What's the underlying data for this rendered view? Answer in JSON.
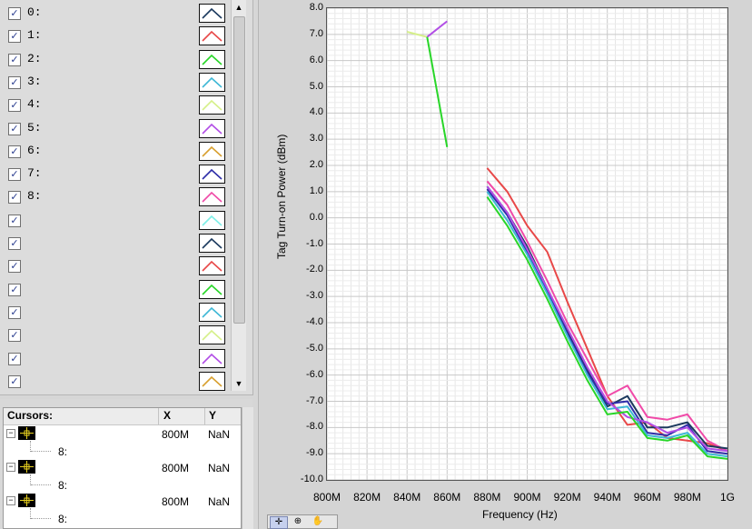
{
  "legend": {
    "plots": [
      {
        "label": "0:",
        "color": "#1c3a5e"
      },
      {
        "label": "1:",
        "color": "#e84848"
      },
      {
        "label": "2:",
        "color": "#28d628"
      },
      {
        "label": "3:",
        "color": "#3fb8d6"
      },
      {
        "label": "4:",
        "color": "#d6f08a"
      },
      {
        "label": "5:",
        "color": "#b24ee6"
      },
      {
        "label": "6:",
        "color": "#d8a030"
      },
      {
        "label": "7:",
        "color": "#2e2ea8"
      },
      {
        "label": "8:",
        "color": "#f04aa8"
      },
      {
        "label": "",
        "color": "#7ef0e8"
      },
      {
        "label": "",
        "color": "#1c3a5e"
      },
      {
        "label": "",
        "color": "#e84848"
      },
      {
        "label": "",
        "color": "#28d628"
      },
      {
        "label": "",
        "color": "#3fb8d6"
      },
      {
        "label": "",
        "color": "#d6f08a"
      },
      {
        "label": "",
        "color": "#b24ee6"
      },
      {
        "label": "",
        "color": "#d8a030"
      }
    ],
    "check_glyph": "☑"
  },
  "cursors": {
    "headers": {
      "name": "Cursors:",
      "x": "X",
      "y": "Y"
    },
    "rows": [
      {
        "x": "800M",
        "y": "NaN",
        "sub": "8:"
      },
      {
        "x": "800M",
        "y": "NaN",
        "sub": "8:"
      },
      {
        "x": "800M",
        "y": "NaN",
        "sub": "8:"
      }
    ]
  },
  "chart_data": {
    "type": "line",
    "xlabel": "Frequency (Hz)",
    "ylabel": "Tag Turn-on Power (dBm)",
    "xlim": [
      800,
      1000
    ],
    "ylim": [
      -10,
      8
    ],
    "x_unit": "MHz",
    "xticks": [
      "800M",
      "820M",
      "840M",
      "860M",
      "880M",
      "900M",
      "920M",
      "940M",
      "960M",
      "980M",
      "1G"
    ],
    "yticks": [
      "8.0",
      "7.0",
      "6.0",
      "5.0",
      "4.0",
      "3.0",
      "2.0",
      "1.0",
      "0.0",
      "-1.0",
      "-2.0",
      "-3.0",
      "-4.0",
      "-5.0",
      "-6.0",
      "-7.0",
      "-8.0",
      "-9.0",
      "-10.0"
    ],
    "grid": true,
    "series": [
      {
        "color": "#d6f08a",
        "points": [
          [
            840,
            7.1
          ],
          [
            850,
            6.9
          ]
        ]
      },
      {
        "color": "#b24ee6",
        "points": [
          [
            850,
            6.9
          ],
          [
            860,
            7.5
          ]
        ]
      },
      {
        "color": "#28d628",
        "points": [
          [
            850,
            6.9
          ],
          [
            860,
            2.7
          ]
        ]
      },
      {
        "color": "#e84848",
        "points": [
          [
            880,
            1.9
          ],
          [
            890,
            1.0
          ],
          [
            900,
            -0.3
          ],
          [
            910,
            -1.3
          ],
          [
            920,
            -3.2
          ],
          [
            930,
            -5.0
          ],
          [
            940,
            -6.8
          ],
          [
            950,
            -7.9
          ],
          [
            960,
            -7.8
          ],
          [
            970,
            -8.4
          ],
          [
            980,
            -8.5
          ],
          [
            990,
            -8.6
          ],
          [
            1000,
            -8.9
          ]
        ]
      },
      {
        "color": "#f04aa8",
        "points": [
          [
            880,
            1.4
          ],
          [
            890,
            0.5
          ],
          [
            900,
            -0.9
          ],
          [
            910,
            -2.4
          ],
          [
            920,
            -4.0
          ],
          [
            930,
            -5.4
          ],
          [
            940,
            -6.8
          ],
          [
            950,
            -6.4
          ],
          [
            960,
            -7.6
          ],
          [
            970,
            -7.7
          ],
          [
            980,
            -7.5
          ],
          [
            990,
            -8.5
          ],
          [
            1000,
            -8.9
          ]
        ]
      },
      {
        "color": "#1c3a5e",
        "points": [
          [
            880,
            1.2
          ],
          [
            890,
            0.2
          ],
          [
            900,
            -1.1
          ],
          [
            910,
            -2.7
          ],
          [
            920,
            -4.3
          ],
          [
            930,
            -5.8
          ],
          [
            940,
            -7.2
          ],
          [
            950,
            -6.8
          ],
          [
            960,
            -8.0
          ],
          [
            970,
            -8.0
          ],
          [
            980,
            -7.8
          ],
          [
            990,
            -8.7
          ],
          [
            1000,
            -8.8
          ]
        ]
      },
      {
        "color": "#2e2ea8",
        "points": [
          [
            880,
            1.1
          ],
          [
            890,
            0.1
          ],
          [
            900,
            -1.3
          ],
          [
            910,
            -2.8
          ],
          [
            920,
            -4.4
          ],
          [
            930,
            -5.9
          ],
          [
            940,
            -7.1
          ],
          [
            950,
            -7.0
          ],
          [
            960,
            -8.2
          ],
          [
            970,
            -8.3
          ],
          [
            980,
            -7.9
          ],
          [
            990,
            -8.9
          ],
          [
            1000,
            -9.0
          ]
        ]
      },
      {
        "color": "#3fb8d6",
        "points": [
          [
            880,
            1.0
          ],
          [
            890,
            -0.1
          ],
          [
            900,
            -1.4
          ],
          [
            910,
            -2.9
          ],
          [
            920,
            -4.5
          ],
          [
            930,
            -6.0
          ],
          [
            940,
            -7.3
          ],
          [
            950,
            -7.2
          ],
          [
            960,
            -8.3
          ],
          [
            970,
            -8.4
          ],
          [
            980,
            -8.2
          ],
          [
            990,
            -9.0
          ],
          [
            1000,
            -9.1
          ]
        ]
      },
      {
        "color": "#b24ee6",
        "points": [
          [
            880,
            1.2
          ],
          [
            890,
            0.2
          ],
          [
            900,
            -1.2
          ],
          [
            910,
            -2.7
          ],
          [
            920,
            -4.2
          ],
          [
            930,
            -5.7
          ],
          [
            940,
            -7.0
          ],
          [
            950,
            -7.6
          ],
          [
            960,
            -7.8
          ],
          [
            970,
            -8.2
          ],
          [
            980,
            -8.0
          ],
          [
            990,
            -8.8
          ],
          [
            1000,
            -8.9
          ]
        ]
      },
      {
        "color": "#28d628",
        "points": [
          [
            880,
            0.8
          ],
          [
            890,
            -0.3
          ],
          [
            900,
            -1.6
          ],
          [
            910,
            -3.1
          ],
          [
            920,
            -4.7
          ],
          [
            930,
            -6.2
          ],
          [
            940,
            -7.5
          ],
          [
            950,
            -7.4
          ],
          [
            960,
            -8.4
          ],
          [
            970,
            -8.5
          ],
          [
            980,
            -8.3
          ],
          [
            990,
            -9.1
          ],
          [
            1000,
            -9.2
          ]
        ]
      }
    ]
  }
}
